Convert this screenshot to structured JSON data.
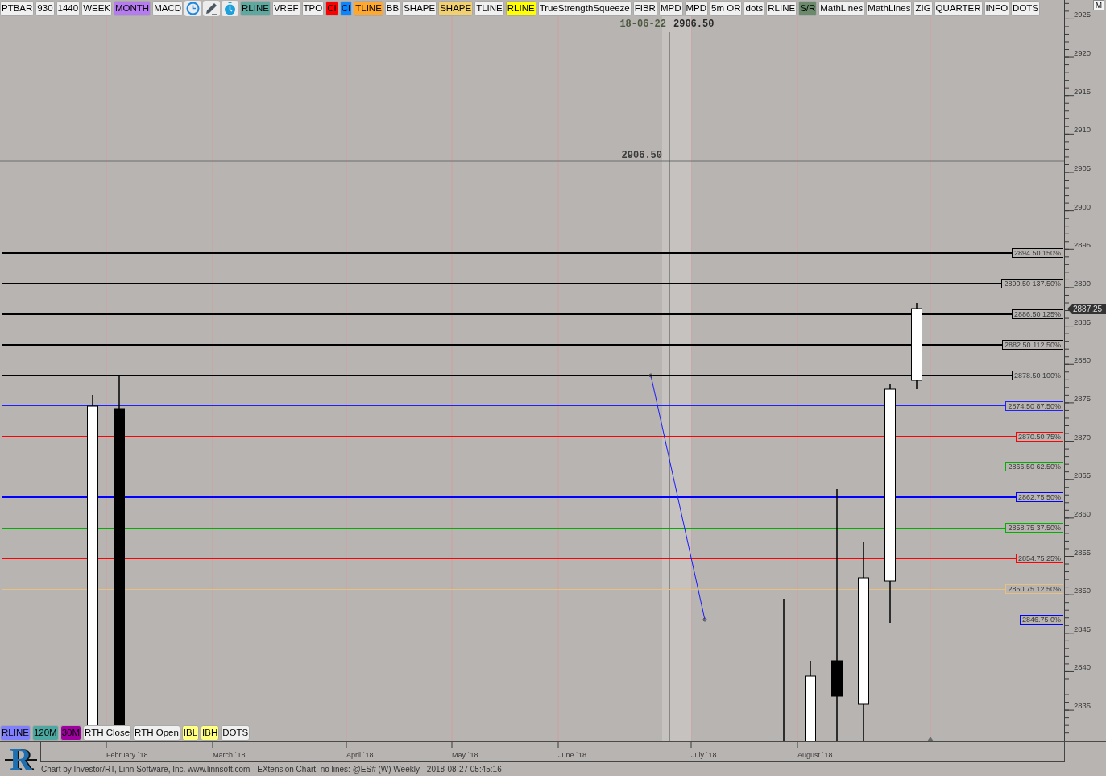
{
  "toolbar_top": [
    {
      "kind": "label",
      "label": "PTBAR",
      "color": "#f0f0f0"
    },
    {
      "kind": "label",
      "label": "930",
      "color": "#f0f0f0"
    },
    {
      "kind": "label",
      "label": "1440",
      "color": "#f0f0f0"
    },
    {
      "kind": "label",
      "label": "WEEK",
      "color": "#f0f0f0"
    },
    {
      "kind": "label",
      "label": "MONTH",
      "color": "#b57cf0"
    },
    {
      "kind": "label",
      "label": "MACD",
      "color": "#f0f0f0"
    },
    {
      "kind": "tool"
    },
    {
      "kind": "tool"
    },
    {
      "kind": "tool"
    },
    {
      "kind": "label",
      "label": "RLINE",
      "color": "#5fa8a0"
    },
    {
      "kind": "label",
      "label": "VREF",
      "color": "#f0f0f0"
    },
    {
      "kind": "label",
      "label": "TPO",
      "color": "#f0f0f0"
    },
    {
      "kind": "label",
      "label": "CI",
      "color": "#ff0000"
    },
    {
      "kind": "label",
      "label": "CI",
      "color": "#0a84ff"
    },
    {
      "kind": "label",
      "label": "TLINE",
      "color": "#ffa830"
    },
    {
      "kind": "label",
      "label": "BB",
      "color": "#f0f0f0"
    },
    {
      "kind": "label",
      "label": "SHAPE",
      "color": "#f0f0f0"
    },
    {
      "kind": "label",
      "label": "SHAPE",
      "color": "#f0d070"
    },
    {
      "kind": "label",
      "label": "TLINE",
      "color": "#f0f0f0"
    },
    {
      "kind": "label",
      "label": "RLINE",
      "color": "#ffff00"
    },
    {
      "kind": "label",
      "label": "TrueStrengthSqueeze",
      "color": "#f0f0f0"
    },
    {
      "kind": "label",
      "label": "FIBR",
      "color": "#f0f0f0"
    },
    {
      "kind": "label",
      "label": "MPD",
      "color": "#f0f0f0"
    },
    {
      "kind": "label",
      "label": "MPD",
      "color": "#f0f0f0"
    },
    {
      "kind": "label",
      "label": "5m OR",
      "color": "#f0f0f0"
    },
    {
      "kind": "label",
      "label": "dots",
      "color": "#f0f0f0"
    },
    {
      "kind": "label",
      "label": "RLINE",
      "color": "#f0f0f0"
    },
    {
      "kind": "label",
      "label": "S/R",
      "color": "#6b8a6b"
    },
    {
      "kind": "label",
      "label": "MathLines",
      "color": "#f0f0f0"
    },
    {
      "kind": "label",
      "label": "MathLines",
      "color": "#f0f0f0"
    },
    {
      "kind": "label",
      "label": "ZIG",
      "color": "#f0f0f0"
    },
    {
      "kind": "label",
      "label": "QUARTER",
      "color": "#f0f0f0"
    },
    {
      "kind": "label",
      "label": "INFO",
      "color": "#f0f0f0"
    },
    {
      "kind": "label",
      "label": "DOTS",
      "color": "#f0f0f0"
    }
  ],
  "corner_button": {
    "label": "M"
  },
  "crosshair": {
    "date": "18-06-22",
    "price": "2906.50"
  },
  "price_line": {
    "label": "2906.50"
  },
  "levels": [
    {
      "label": "2894.50 150%",
      "color": "#000000",
      "thick": true,
      "dashed": false
    },
    {
      "label": "2890.50 137.50%",
      "color": "#000000",
      "thick": true,
      "dashed": false
    },
    {
      "label": "2886.50 125%",
      "color": "#000000",
      "thick": true,
      "dashed": false
    },
    {
      "label": "2882.50 112.50%",
      "color": "#000000",
      "thick": true,
      "dashed": false
    },
    {
      "label": "2878.50 100%",
      "color": "#000000",
      "thick": true,
      "dashed": false
    },
    {
      "label": "2874.50 87.50%",
      "color": "#2020ff",
      "thick": false,
      "dashed": false
    },
    {
      "label": "2870.50 75%",
      "color": "#ff0000",
      "thick": false,
      "dashed": false
    },
    {
      "label": "2866.50 62.50%",
      "color": "#00b000",
      "thick": false,
      "dashed": false
    },
    {
      "label": "2862.75 50%",
      "color": "#0000ff",
      "thick": true,
      "dashed": false
    },
    {
      "label": "2858.75 37.50%",
      "color": "#00b000",
      "thick": false,
      "dashed": false
    },
    {
      "label": "2854.75 25%",
      "color": "#ff0000",
      "thick": false,
      "dashed": false
    },
    {
      "label": "2850.75 12.50%",
      "color": "#e8c080",
      "thick": false,
      "dashed": false
    },
    {
      "label": "2846.75 0%",
      "color": "#0000ff",
      "thick": false,
      "dashed": true
    }
  ],
  "price_axis": {
    "labels": [
      "2925",
      "2920",
      "2915",
      "2910",
      "2905",
      "2900",
      "2895",
      "2890",
      "2885",
      "2880",
      "2875",
      "2870",
      "2865",
      "2860",
      "2855",
      "2850",
      "2845",
      "2840",
      "2835"
    ],
    "current_price": "2887.25"
  },
  "toolbar_bottom": [
    {
      "label": "RLINE",
      "color": "#8080ff"
    },
    {
      "label": "120M",
      "color": "#4ca8a0"
    },
    {
      "label": "30M",
      "color": "#a000a0"
    },
    {
      "label": "RTH Close",
      "color": "#f0f0f0"
    },
    {
      "label": "RTH Open",
      "color": "#f0f0f0"
    },
    {
      "label": "IBL",
      "color": "#ffff80"
    },
    {
      "label": "IBH",
      "color": "#ffff80"
    },
    {
      "label": "DOTS",
      "color": "#f0f0f0"
    }
  ],
  "logo": {
    "letter": "R"
  },
  "time_axis": {
    "labels": [
      "February `18",
      "March `18",
      "April `18",
      "May `18",
      "June `18",
      "July `18",
      "August `18"
    ]
  },
  "footer": "Chart by Investor/RT, Linn Software, Inc. www.linnsoft.com - EXtension Chart, no lines: @ES# (W) Weekly - 2018-08-27 05:45:16"
}
